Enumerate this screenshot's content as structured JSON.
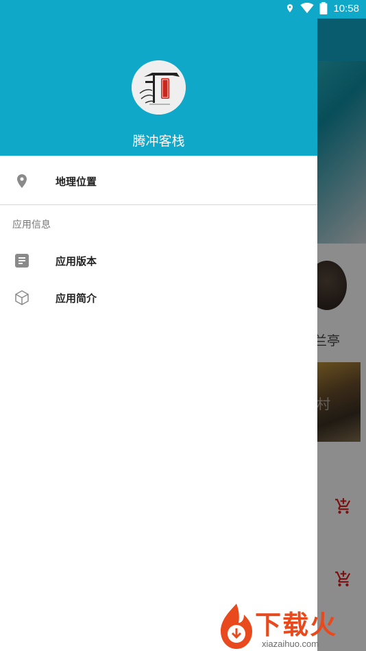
{
  "status_bar": {
    "time": "10:58",
    "icons": [
      "location-icon",
      "wifi-icon",
      "battery-icon"
    ]
  },
  "drawer": {
    "header": {
      "app_name": "腾冲客栈",
      "logo": "inn-logo"
    },
    "items": [
      {
        "icon": "location-pin-icon",
        "label": "地理位置"
      }
    ],
    "section_title": "应用信息",
    "info_items": [
      {
        "icon": "document-icon",
        "label": "应用版本"
      },
      {
        "icon": "cube-icon",
        "label": "应用简介"
      }
    ]
  },
  "background": {
    "partial_label": "兰亭",
    "photo_partial_text": "村",
    "cart_icons": [
      "add-cart-icon",
      "add-cart-icon"
    ]
  },
  "watermark": {
    "text": "下载火",
    "site": "xiazaihuo.com"
  },
  "colors": {
    "primary": "#10a8c9",
    "cart_red": "#e21b1b",
    "watermark_orange": "#e84a1d"
  }
}
